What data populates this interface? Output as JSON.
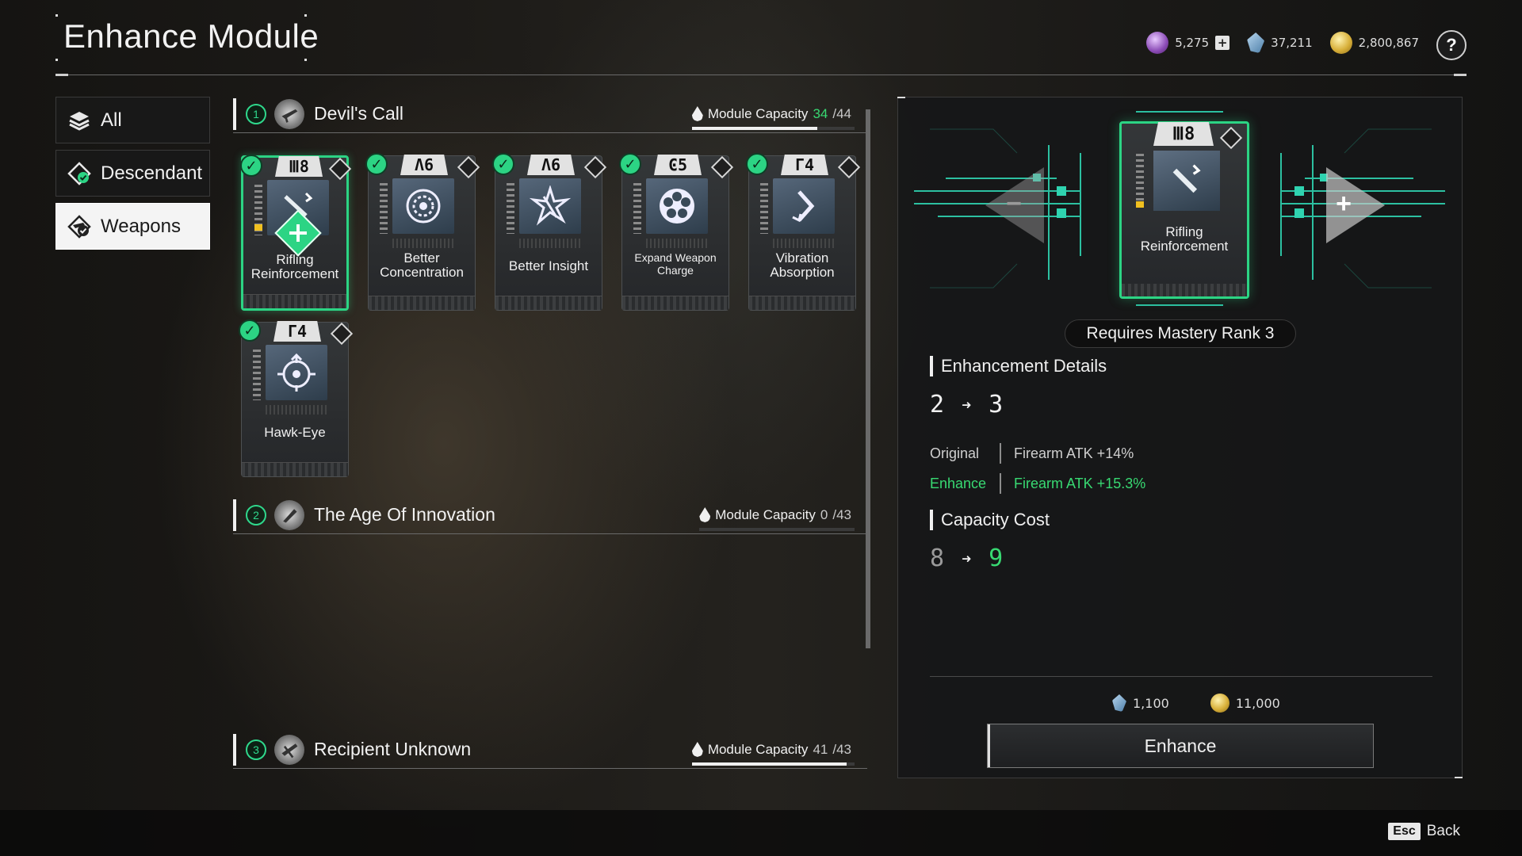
{
  "header": {
    "title": "Enhance Module"
  },
  "currencies": [
    {
      "icon": "purple-orb-icon",
      "value": "5,275",
      "has_plus": true
    },
    {
      "icon": "kuiper-crystal-icon",
      "value": "37,211"
    },
    {
      "icon": "gold-coin-icon",
      "value": "2,800,867"
    }
  ],
  "help_label": "?",
  "sidebar": {
    "items": [
      {
        "label": "All",
        "icon": "layers-icon"
      },
      {
        "label": "Descendant",
        "icon": "descendant-icon"
      },
      {
        "label": "Weapons",
        "icon": "weapon-icon"
      }
    ]
  },
  "sections": [
    {
      "num": "1",
      "title": "Devil's Call",
      "cap_label": "Module Capacity",
      "cap_used": "34",
      "cap_total": "/44",
      "cap_fraction": 0.77
    },
    {
      "num": "2",
      "title": "The Age Of Innovation",
      "cap_label": "Module Capacity",
      "cap_used": "0",
      "cap_total": "/43",
      "cap_fraction": 0
    },
    {
      "num": "3",
      "title": "Recipient Unknown",
      "cap_label": "Module Capacity",
      "cap_used": "41",
      "cap_total": "/43",
      "cap_fraction": 0.95
    }
  ],
  "modules": [
    {
      "name": "Rifling Reinforcement",
      "rank": "Ⅲ8",
      "icon": "rifling-icon"
    },
    {
      "name": "Better Concentration",
      "rank": "Λ6",
      "icon": "concentration-icon"
    },
    {
      "name": "Better Insight",
      "rank": "Λ6",
      "icon": "insight-icon"
    },
    {
      "name": "Expand Weapon Charge",
      "rank": "Ͼ5",
      "icon": "charge-icon"
    },
    {
      "name": "Vibration Absorption",
      "rank": "Γ4",
      "icon": "vibration-icon"
    },
    {
      "name": "Hawk-Eye",
      "rank": "Γ4",
      "icon": "crosshair-icon"
    }
  ],
  "detail": {
    "module_name": "Rifling Reinforcement",
    "rank": "Ⅲ8",
    "requirement": "Requires Mastery Rank 3",
    "enh_heading": "Enhancement Details",
    "level_from": "2",
    "level_to": "3",
    "original_label": "Original",
    "original_value": "Firearm ATK +14%",
    "enhance_label": "Enhance",
    "enhance_value": "Firearm ATK +15.3%",
    "cap_heading": "Capacity Cost",
    "cost_from": "8",
    "cost_to": "9",
    "price_crystal": "1,100",
    "price_gold": "11,000",
    "button": "Enhance"
  },
  "footer": {
    "key": "Esc",
    "label": "Back"
  },
  "colors": {
    "accent": "#2cd484",
    "green_text": "#38d972"
  }
}
